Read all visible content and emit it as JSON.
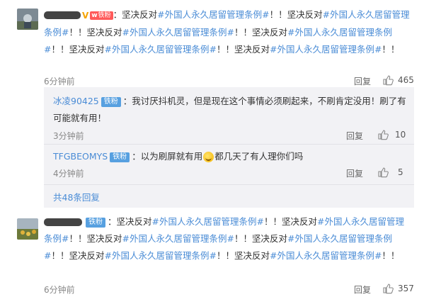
{
  "comments": [
    {
      "vip_mark": "V",
      "fan_badge": {
        "prefix": "w",
        "label": "铁粉"
      },
      "segments": [
        {
          "t": "：坚决反对",
          "topic": false
        },
        {
          "t": "#外国人永久居留管理条例#",
          "topic": true
        },
        {
          "t": "！！坚决反对",
          "topic": false
        },
        {
          "t": "#外国人永久居留管理条例#",
          "topic": true
        },
        {
          "t": "！！坚决反对",
          "topic": false
        },
        {
          "t": "#外国人永久居留管理条例#",
          "topic": true
        },
        {
          "t": "！！坚决反对",
          "topic": false
        },
        {
          "t": "#外国人永久居留管理条例#",
          "topic": true
        },
        {
          "t": "！！坚决反对",
          "topic": false
        },
        {
          "t": "#外国人永久居留管理条例#",
          "topic": true
        },
        {
          "t": "！！坚决反对",
          "topic": false
        },
        {
          "t": "#外国人永久居留管理条例#",
          "topic": true
        },
        {
          "t": "！！",
          "topic": false
        }
      ],
      "time": "6分钟前",
      "reply_label": "回复",
      "likes": "465"
    },
    {
      "fan_badge": {
        "label": "铁粉"
      },
      "segments": [
        {
          "t": "：坚决反对",
          "topic": false
        },
        {
          "t": "#外国人永久居留管理条例#",
          "topic": true
        },
        {
          "t": "！！坚决反对",
          "topic": false
        },
        {
          "t": "#外国人永久居留管理条例#",
          "topic": true
        },
        {
          "t": "！！坚决反对",
          "topic": false
        },
        {
          "t": "#外国人永久居留管理条例#",
          "topic": true
        },
        {
          "t": "！！坚决反对",
          "topic": false
        },
        {
          "t": "#外国人永久居留管理条例#",
          "topic": true
        },
        {
          "t": "！！坚决反对",
          "topic": false
        },
        {
          "t": "#外国人永久居留管理条例#",
          "topic": true
        },
        {
          "t": "！！坚决反对",
          "topic": false
        },
        {
          "t": "#外国人永久居留管理条例#",
          "topic": true
        },
        {
          "t": "！！",
          "topic": false
        }
      ],
      "time": "6分钟前",
      "reply_label": "回复",
      "likes": "357"
    }
  ],
  "replies": [
    {
      "user": "冰凌90425",
      "badge": "铁粉",
      "text": "：我讨厌抖机灵，但是现在这个事情必须刷起来，不刷肯定没用！刷了有可能就有用！",
      "time": "3分钟前",
      "reply_label": "回复",
      "likes": "10"
    },
    {
      "user": "TFGBEOMYS",
      "badge": "铁粉",
      "text_before": "：以为刷屏就有用",
      "text_after": "都几天了有人理你们吗",
      "time": "4分钟前",
      "reply_label": "回复",
      "likes": "5"
    }
  ],
  "more_replies": "共48条回复",
  "colors": {
    "link": "#4a8cd6",
    "badge": "#57a0e0",
    "reply_bg": "#f2f2f5"
  },
  "icons": {
    "like": "thumbs-up-icon"
  }
}
